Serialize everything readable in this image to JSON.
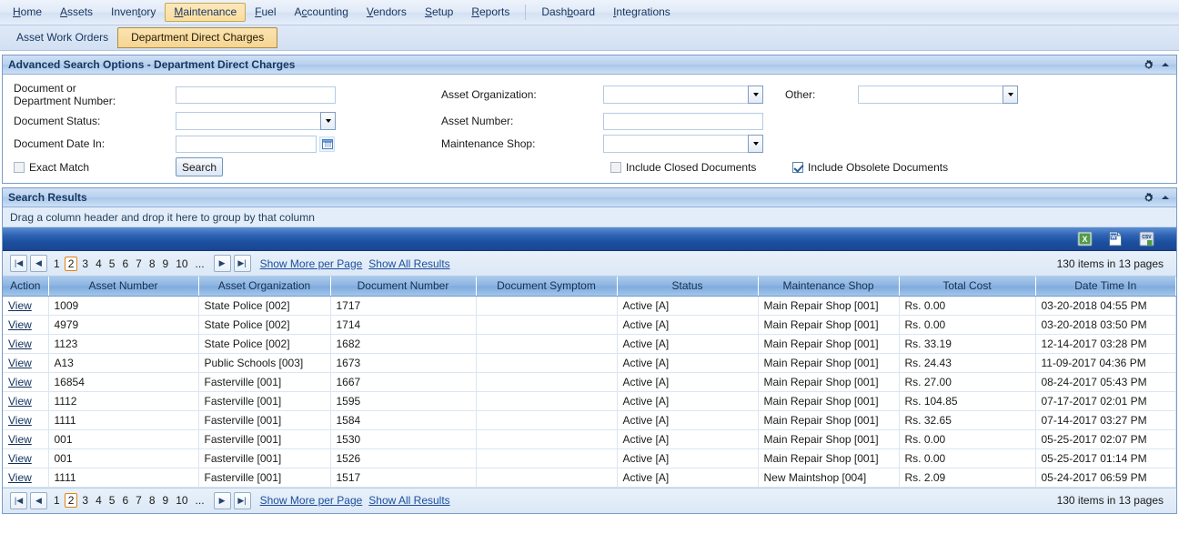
{
  "menu": {
    "items": [
      {
        "label": "Home",
        "underline_index": 0,
        "active": false
      },
      {
        "label": "Assets",
        "underline_index": 0,
        "active": false
      },
      {
        "label": "Inventory",
        "underline_index": 5,
        "active": false
      },
      {
        "label": "Maintenance",
        "underline_index": 0,
        "active": true
      },
      {
        "label": "Fuel",
        "underline_index": 0,
        "active": false
      },
      {
        "label": "Accounting",
        "underline_index": 1,
        "active": false
      },
      {
        "label": "Vendors",
        "underline_index": 0,
        "active": false
      },
      {
        "label": "Setup",
        "underline_index": 0,
        "active": false
      },
      {
        "label": "Reports",
        "underline_index": 0,
        "active": false
      },
      {
        "label": "Dashboard",
        "underline_index": 4,
        "active": false
      },
      {
        "label": "Integrations",
        "underline_index": 0,
        "active": false
      }
    ],
    "separator_after_index": 8
  },
  "subtabs": [
    {
      "label": "Asset Work Orders",
      "active": false
    },
    {
      "label": "Department Direct Charges",
      "active": true
    }
  ],
  "search_panel": {
    "title": "Advanced Search Options - Department Direct Charges",
    "gear_icon": "gear-icon",
    "collapse_icon": "chevron-up-icon",
    "fields": {
      "document_or_department_number": {
        "label_line1": "Document or",
        "label_line2": "Department Number:",
        "value": "",
        "placeholder": ""
      },
      "document_status": {
        "label": "Document Status:",
        "value": ""
      },
      "document_date_in": {
        "label": "Document Date In:",
        "value": "",
        "calendar_icon": "calendar-icon"
      },
      "asset_organization": {
        "label": "Asset Organization:",
        "value": ""
      },
      "asset_number": {
        "label": "Asset Number:",
        "value": "",
        "placeholder": ""
      },
      "maintenance_shop": {
        "label": "Maintenance Shop:",
        "value": ""
      },
      "other": {
        "label": "Other:",
        "value": ""
      }
    },
    "checkboxes": {
      "exact_match": {
        "label": "Exact Match",
        "checked": false
      },
      "include_closed": {
        "label": "Include Closed Documents",
        "checked": false
      },
      "include_obsolete": {
        "label": "Include Obsolete Documents",
        "checked": true
      }
    },
    "search_button": "Search"
  },
  "results_panel": {
    "title": "Search Results",
    "gear_icon": "gear-icon",
    "collapse_icon": "chevron-up-icon",
    "group_hint": "Drag a column header and drop it here to group by that column",
    "export_icons": [
      "export-excel-icon",
      "export-word-icon",
      "export-csv-icon"
    ],
    "pager": {
      "first_label": "|◀",
      "prev_label": "◀",
      "next_label": "▶",
      "last_label": "▶|",
      "pages": [
        "1",
        "2",
        "3",
        "4",
        "5",
        "6",
        "7",
        "8",
        "9",
        "10",
        "..."
      ],
      "current_page": "2",
      "show_more_label": "Show More per Page",
      "show_all_label": "Show All Results",
      "item_count": "130 items in 13 pages"
    },
    "columns": [
      "Action",
      "Asset Number",
      "Asset Organization",
      "Document Number",
      "Document Symptom",
      "Status",
      "Maintenance Shop",
      "Total Cost",
      "Date Time In"
    ],
    "action_label": "View",
    "rows": [
      {
        "asset_number": "1009",
        "asset_organization": "State Police [002]",
        "document_number": "1717",
        "document_symptom": "",
        "status": "Active [A]",
        "maintenance_shop": "Main Repair Shop [001]",
        "total_cost": "Rs. 0.00",
        "date_time_in": "03-20-2018 04:55 PM"
      },
      {
        "asset_number": "4979",
        "asset_organization": "State Police [002]",
        "document_number": "1714",
        "document_symptom": "",
        "status": "Active [A]",
        "maintenance_shop": "Main Repair Shop [001]",
        "total_cost": "Rs. 0.00",
        "date_time_in": "03-20-2018 03:50 PM"
      },
      {
        "asset_number": "1123",
        "asset_organization": "State Police [002]",
        "document_number": "1682",
        "document_symptom": "",
        "status": "Active [A]",
        "maintenance_shop": "Main Repair Shop [001]",
        "total_cost": "Rs. 33.19",
        "date_time_in": "12-14-2017 03:28 PM"
      },
      {
        "asset_number": "A13",
        "asset_organization": "Public Schools [003]",
        "document_number": "1673",
        "document_symptom": "",
        "status": "Active [A]",
        "maintenance_shop": "Main Repair Shop [001]",
        "total_cost": "Rs. 24.43",
        "date_time_in": "11-09-2017 04:36 PM"
      },
      {
        "asset_number": "16854",
        "asset_organization": "Fasterville [001]",
        "document_number": "1667",
        "document_symptom": "",
        "status": "Active [A]",
        "maintenance_shop": "Main Repair Shop [001]",
        "total_cost": "Rs. 27.00",
        "date_time_in": "08-24-2017 05:43 PM"
      },
      {
        "asset_number": "1112",
        "asset_organization": "Fasterville [001]",
        "document_number": "1595",
        "document_symptom": "",
        "status": "Active [A]",
        "maintenance_shop": "Main Repair Shop [001]",
        "total_cost": "Rs. 104.85",
        "date_time_in": "07-17-2017 02:01 PM"
      },
      {
        "asset_number": "1111",
        "asset_organization": "Fasterville [001]",
        "document_number": "1584",
        "document_symptom": "",
        "status": "Active [A]",
        "maintenance_shop": "Main Repair Shop [001]",
        "total_cost": "Rs. 32.65",
        "date_time_in": "07-14-2017 03:27 PM"
      },
      {
        "asset_number": "001",
        "asset_organization": "Fasterville [001]",
        "document_number": "1530",
        "document_symptom": "",
        "status": "Active [A]",
        "maintenance_shop": "Main Repair Shop [001]",
        "total_cost": "Rs. 0.00",
        "date_time_in": "05-25-2017 02:07 PM"
      },
      {
        "asset_number": "001",
        "asset_organization": "Fasterville [001]",
        "document_number": "1526",
        "document_symptom": "",
        "status": "Active [A]",
        "maintenance_shop": "Main Repair Shop [001]",
        "total_cost": "Rs. 0.00",
        "date_time_in": "05-25-2017 01:14 PM"
      },
      {
        "asset_number": "1111",
        "asset_organization": "Fasterville [001]",
        "document_number": "1517",
        "document_symptom": "",
        "status": "Active [A]",
        "maintenance_shop": "New Maintshop [004]",
        "total_cost": "Rs. 2.09",
        "date_time_in": "05-24-2017 06:59 PM"
      }
    ]
  },
  "colors": {
    "accent_blue": "#1c4f9f",
    "header_blue": "#8cb4e2",
    "active_tab_gold": "#f6d594",
    "current_page_orange": "#e08214",
    "link_blue": "#1c4e9e"
  }
}
